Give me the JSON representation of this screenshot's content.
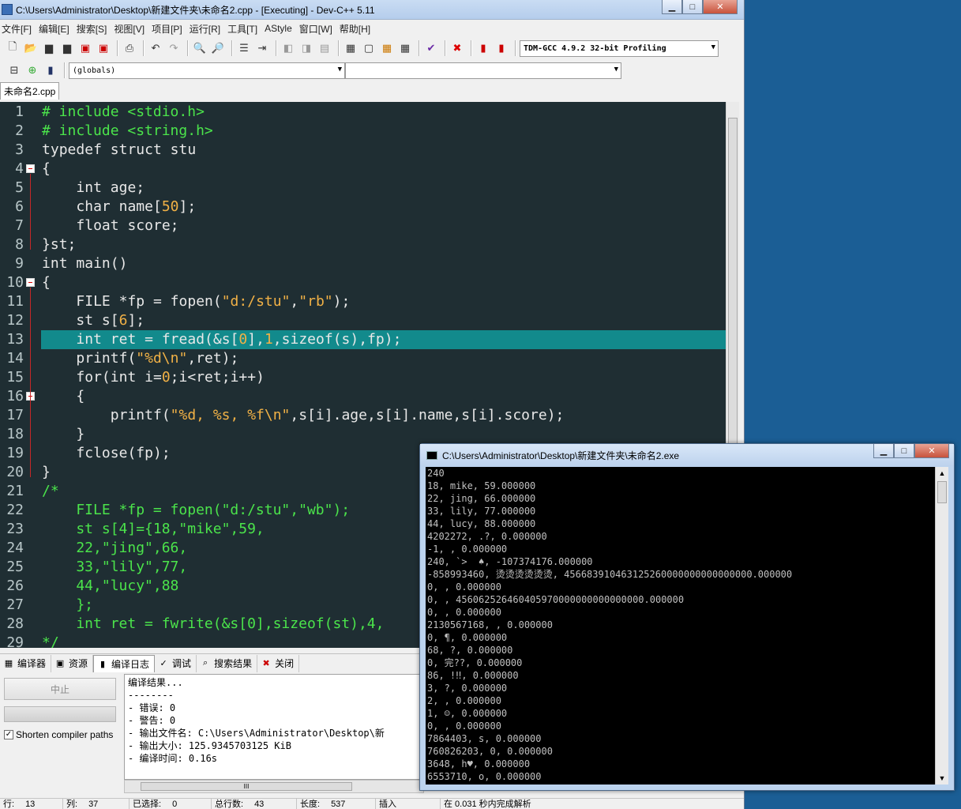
{
  "ide": {
    "title": "C:\\Users\\Administrator\\Desktop\\新建文件夹\\未命名2.cpp - [Executing] - Dev-C++ 5.11",
    "menu": [
      "文件[F]",
      "编辑[E]",
      "搜索[S]",
      "视图[V]",
      "项目[P]",
      "运行[R]",
      "工具[T]",
      "AStyle",
      "窗口[W]",
      "帮助[H]"
    ],
    "compiler_select": "TDM-GCC 4.9.2 32-bit Profiling",
    "scope_select": "(globals)",
    "member_select": "",
    "file_tab": "未命名2.cpp",
    "current_line": 13
  },
  "editor": {
    "lines": [
      {
        "n": "1",
        "text": "# include <stdio.h>",
        "fold": false
      },
      {
        "n": "2",
        "text": "# include <string.h>",
        "fold": false
      },
      {
        "n": "3",
        "text": "typedef struct stu",
        "fold": false
      },
      {
        "n": "4",
        "text": "{",
        "fold": true
      },
      {
        "n": "5",
        "text": "    int age;",
        "fold": false
      },
      {
        "n": "6",
        "text": "    char name[50];",
        "fold": false
      },
      {
        "n": "7",
        "text": "    float score;",
        "fold": false
      },
      {
        "n": "8",
        "text": "}st;",
        "fold": false
      },
      {
        "n": "9",
        "text": "int main()",
        "fold": false
      },
      {
        "n": "10",
        "text": "{",
        "fold": true
      },
      {
        "n": "11",
        "text": "    FILE *fp = fopen(\"d:/stu\",\"rb\");",
        "fold": false
      },
      {
        "n": "12",
        "text": "    st s[6];",
        "fold": false
      },
      {
        "n": "13",
        "text": "    int ret = fread(&s[0],1,sizeof(s),fp);",
        "fold": false
      },
      {
        "n": "14",
        "text": "    printf(\"%d\\n\",ret);",
        "fold": false
      },
      {
        "n": "15",
        "text": "    for(int i=0;i<ret;i++)",
        "fold": false
      },
      {
        "n": "16",
        "text": "    {",
        "fold": true
      },
      {
        "n": "17",
        "text": "        printf(\"%d, %s, %f\\n\",s[i].age,s[i].name,s[i].score);",
        "fold": false
      },
      {
        "n": "18",
        "text": "    }",
        "fold": false
      },
      {
        "n": "19",
        "text": "    fclose(fp);",
        "fold": false
      },
      {
        "n": "20",
        "text": "}",
        "fold": false
      },
      {
        "n": "21",
        "text": "/*",
        "fold": false
      },
      {
        "n": "22",
        "text": "    FILE *fp = fopen(\"d:/stu\",\"wb\");",
        "fold": false
      },
      {
        "n": "23",
        "text": "    st s[4]={18,\"mike\",59,",
        "fold": false
      },
      {
        "n": "24",
        "text": "    22,\"jing\",66,",
        "fold": false
      },
      {
        "n": "25",
        "text": "    33,\"lily\",77,",
        "fold": false
      },
      {
        "n": "26",
        "text": "    44,\"lucy\",88",
        "fold": false
      },
      {
        "n": "27",
        "text": "    };",
        "fold": false
      },
      {
        "n": "28",
        "text": "    int ret = fwrite(&s[0],sizeof(st),4,",
        "fold": false
      },
      {
        "n": "29",
        "text": "*/",
        "fold": false
      }
    ]
  },
  "bottom": {
    "tabs": [
      {
        "label": "编译器",
        "icon": "grid-icon",
        "active": false
      },
      {
        "label": "资源",
        "icon": "resource-icon",
        "active": false
      },
      {
        "label": "编译日志",
        "icon": "chart-icon",
        "active": true
      },
      {
        "label": "调试",
        "icon": "check-icon",
        "active": false
      },
      {
        "label": "搜索结果",
        "icon": "search-icon",
        "active": false
      },
      {
        "label": "关闭",
        "icon": "close-icon",
        "active": false
      }
    ],
    "abort_label": "中止",
    "shorten_label": "Shorten compiler paths",
    "shorten_checked": true,
    "log": [
      "编译结果...",
      "--------",
      "- 错误: 0",
      "- 警告: 0",
      "- 输出文件名: C:\\Users\\Administrator\\Desktop\\新",
      "- 输出大小: 125.9345703125 KiB",
      "- 编译时间: 0.16s"
    ],
    "hscroll_grip": "III"
  },
  "status": {
    "row_label": "行:",
    "row": "13",
    "col_label": "列:",
    "col": "37",
    "sel_label": "已选择:",
    "sel": "0",
    "total_label": "总行数:",
    "total": "43",
    "len_label": "长度:",
    "len": "537",
    "mode": "插入",
    "parse": "在 0.031 秒内完成解析"
  },
  "console": {
    "title": "C:\\Users\\Administrator\\Desktop\\新建文件夹\\未命名2.exe",
    "output": [
      "240",
      "18, mike, 59.000000",
      "22, jing, 66.000000",
      "33, lily, 77.000000",
      "44, lucy, 88.000000",
      "4202272, .?, 0.000000",
      "-1, , 0.000000",
      "240, `>  ♠, -107374176.000000",
      "-858993460, 烫烫烫烫烫烫, 456683910463125260000000000000000.000000",
      "0, , 0.000000",
      "0, , 456062526460405970000000000000000.000000",
      "0, , 0.000000",
      "2130567168, , 0.000000",
      "0, ¶, 0.000000",
      "68, ?, 0.000000",
      "0, 完??, 0.000000",
      "86, !‼, 0.000000",
      "3, ?, 0.000000",
      "2, , 0.000000",
      "1, ☺, 0.000000",
      "0, , 0.000000",
      "7864403, s, 0.000000",
      "760826203, 0, 0.000000",
      "3648, h♥, 0.000000",
      "6553710, o, 0.000000"
    ]
  }
}
